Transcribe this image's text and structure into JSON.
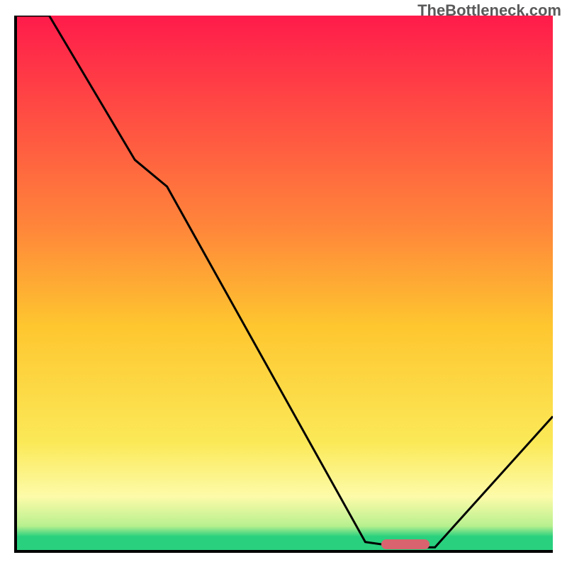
{
  "watermark": "TheBottleneck.com",
  "colors": {
    "grad_top": "#ff1b4b",
    "grad_mid_upper": "#ff873a",
    "grad_mid": "#fec62f",
    "grad_mid_lower": "#fbe958",
    "grad_pale": "#fdfba9",
    "grad_lightgreen": "#b8f08f",
    "grad_green": "#29d07e",
    "axis": "#000000",
    "curve": "#000000",
    "marker": "#d9636e"
  },
  "chart_data": {
    "type": "line",
    "title": "",
    "xlabel": "",
    "ylabel": "",
    "xlim": [
      0,
      100
    ],
    "ylim": [
      0,
      100
    ],
    "x": [
      0,
      6,
      22,
      28,
      65,
      72,
      78,
      100
    ],
    "values": [
      100,
      100,
      73,
      68,
      1.5,
      0.5,
      0.5,
      25
    ],
    "marker": {
      "x_start": 68,
      "x_end": 77,
      "y": 0.5
    },
    "gradient_stops": [
      {
        "pos": 0.0,
        "key": "grad_top"
      },
      {
        "pos": 0.4,
        "key": "grad_mid_upper"
      },
      {
        "pos": 0.58,
        "key": "grad_mid"
      },
      {
        "pos": 0.8,
        "key": "grad_mid_lower"
      },
      {
        "pos": 0.9,
        "key": "grad_pale"
      },
      {
        "pos": 0.955,
        "key": "grad_lightgreen"
      },
      {
        "pos": 0.975,
        "key": "grad_green"
      },
      {
        "pos": 1.0,
        "key": "grad_green"
      }
    ]
  }
}
